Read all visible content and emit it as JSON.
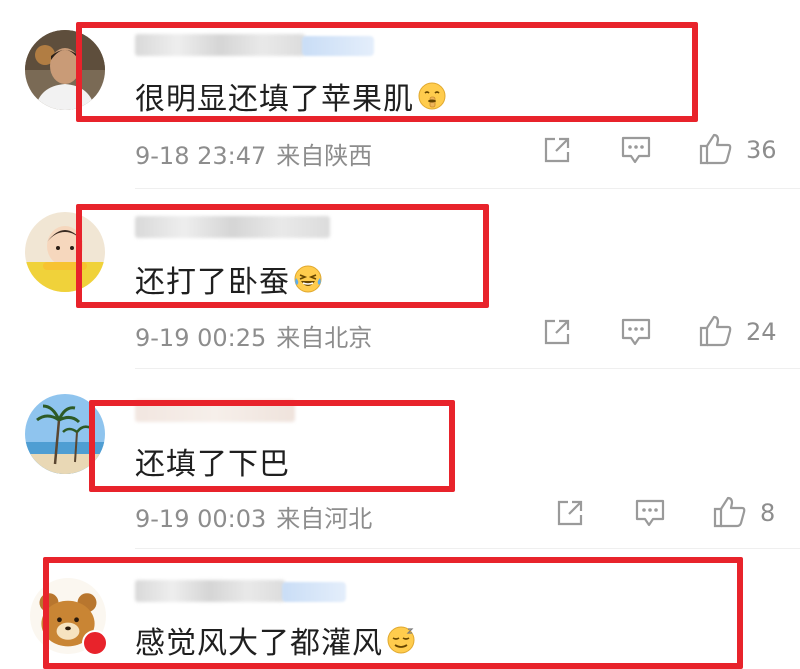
{
  "comments": [
    {
      "text": "很明显还填了苹果肌",
      "emoji": "shushing-face-icon",
      "time": "9-18 23:47",
      "location": "来自陕西",
      "likes": "36"
    },
    {
      "text": "还打了卧蚕",
      "emoji": "laughing-tears-icon",
      "time": "9-19 00:25",
      "location": "来自北京",
      "likes": "24"
    },
    {
      "text": "还填了下巴",
      "emoji": "",
      "time": "9-19 00:03",
      "location": "来自河北",
      "likes": "8"
    },
    {
      "text": "感觉风大了都灌风",
      "emoji": "relieved-face-icon",
      "time": "",
      "location": "",
      "likes": ""
    }
  ],
  "colors": {
    "highlight_box": "#e8232b",
    "meta_text": "#8d8d8d",
    "icon_gray": "#9a9a9a"
  }
}
